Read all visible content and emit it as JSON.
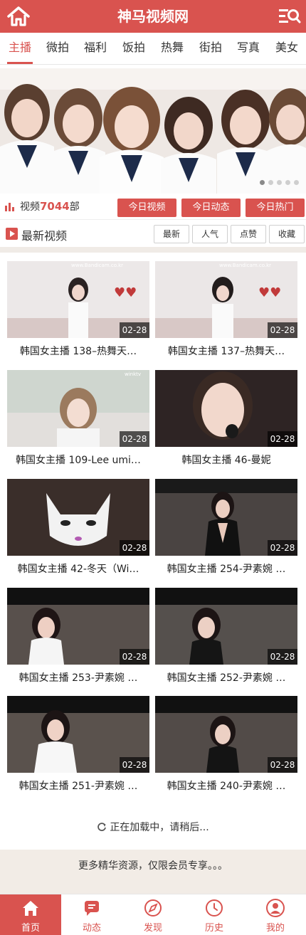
{
  "header": {
    "title": "神马视频网"
  },
  "tabs": [
    "主播",
    "微拍",
    "福利",
    "饭拍",
    "热舞",
    "街拍",
    "写真",
    "美女"
  ],
  "stats": {
    "label": "视频",
    "count": "7044",
    "unit": "部"
  },
  "stat_buttons": [
    "今日视频",
    "今日动态",
    "今日热门"
  ],
  "latest": {
    "label": "最新视频",
    "filters": [
      "最新",
      "人气",
      "点赞",
      "收藏"
    ]
  },
  "videos": [
    {
      "date": "02-28",
      "title": "韩国女主播 138–热舞天…",
      "watermark": "www.Bandicam.co.kr"
    },
    {
      "date": "02-28",
      "title": "韩国女主播 137–热舞天…",
      "watermark": "www.Bandicam.co.kr"
    },
    {
      "date": "02-28",
      "title": "韩国女主播 109-Lee umi…",
      "watermark": "winktv"
    },
    {
      "date": "02-28",
      "title": "韩国女主播 46-曼妮",
      "watermark": ""
    },
    {
      "date": "02-28",
      "title": "韩国女主播 42-冬天（Wi…",
      "watermark": ""
    },
    {
      "date": "02-28",
      "title": "韩国女主播 254-尹素婉 …",
      "watermark": ""
    },
    {
      "date": "02-28",
      "title": "韩国女主播 253-尹素婉 …",
      "watermark": ""
    },
    {
      "date": "02-28",
      "title": "韩国女主播 252-尹素婉 …",
      "watermark": ""
    },
    {
      "date": "02-28",
      "title": "韩国女主播 251-尹素婉 …",
      "watermark": ""
    },
    {
      "date": "02-28",
      "title": "韩国女主播 240-尹素婉 …",
      "watermark": ""
    }
  ],
  "loading_text": "正在加载中，请稍后...",
  "more_text": "更多精华资源，仅限会员专享。。。",
  "bottom_nav": [
    "首页",
    "动态",
    "发现",
    "历史",
    "我的"
  ],
  "colors": {
    "accent": "#d9534f"
  },
  "icons": {
    "home": "home-icon",
    "menu": "search-menu-icon"
  }
}
